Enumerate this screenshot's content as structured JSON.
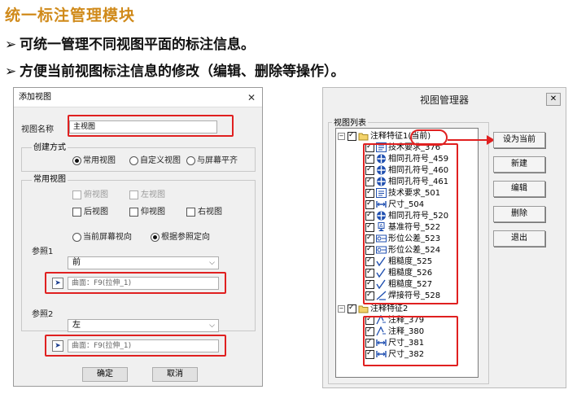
{
  "header": {
    "title": "统一标注管理模块",
    "bullets": [
      "可统一管理不同视图平面的标注信息。",
      "方便当前视图标注信息的修改（编辑、删除等操作）。"
    ],
    "bullet_glyph": "➢"
  },
  "dialog1": {
    "title": "添加视图",
    "close": "✕",
    "view_name_label": "视图名称",
    "view_name_value": "主视图",
    "create_mode": {
      "label": "创建方式",
      "options": [
        "常用视图",
        "自定义视图",
        "与屏幕平齐"
      ],
      "selected": "常用视图"
    },
    "common_views": {
      "label": "常用视图",
      "items": [
        "俯视图",
        "左视图",
        "后视图",
        "仰视图",
        "右视图"
      ]
    },
    "orient": {
      "options": [
        "当前屏幕视向",
        "根据参照定向"
      ],
      "selected": "根据参照定向"
    },
    "ref1": {
      "label": "参照1",
      "select": "前",
      "input": "曲面：F9(拉伸_1)"
    },
    "ref2": {
      "label": "参照2",
      "select": "左",
      "input": "曲面：F9(拉伸_1)"
    },
    "ok": "确定",
    "cancel": "取消"
  },
  "dialog2": {
    "title": "视图管理器",
    "close": "✕",
    "list_label": "视图列表",
    "group1": {
      "label": "注释特征1(当前)",
      "items": [
        "技术要求_376",
        "相同孔符号_459",
        "相同孔符号_460",
        "相同孔符号_461",
        "技术要求_501",
        "尺寸_504",
        "相同孔符号_520",
        "基准符号_522",
        "形位公差_523",
        "形位公差_524",
        "粗糙度_525",
        "粗糙度_526",
        "粗糙度_527",
        "焊接符号_528"
      ]
    },
    "group2": {
      "label": "注释特征2",
      "items": [
        "注释_379",
        "注释_380",
        "尺寸_381",
        "尺寸_382"
      ]
    },
    "buttons": [
      "设为当前",
      "新建",
      "编辑",
      "删除",
      "退出"
    ]
  },
  "colors": {
    "accent_title": "#d08a1a",
    "highlight": "#e02020"
  }
}
